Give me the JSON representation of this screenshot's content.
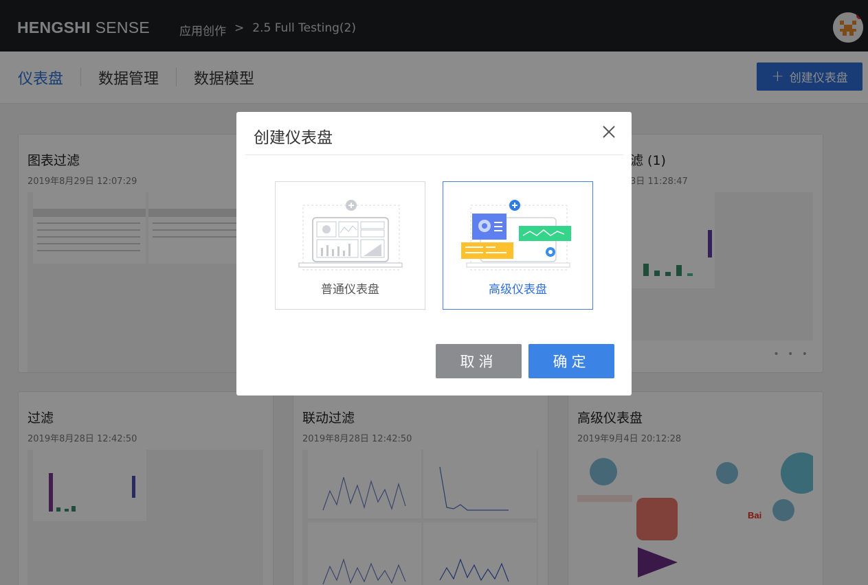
{
  "header": {
    "brand_bold": "HENGSHI",
    "brand_light": " SENSE",
    "breadcrumb": [
      "应用创作",
      ">",
      "2.5 Full Testing(2)"
    ]
  },
  "nav": {
    "tabs": [
      "仪表盘",
      "数据管理",
      "数据模型"
    ],
    "active_tab": "仪表盘",
    "create_label": "创建仪表盘",
    "accent_color": "#2e6ed8"
  },
  "cards": [
    {
      "title": "图表过滤",
      "date": "2019年8月29日 12:07:29"
    },
    {
      "title": "滤 (1)",
      "date": "3日 11:28:47"
    },
    {
      "title": "过滤",
      "date": "2019年8月28日 12:42:50"
    },
    {
      "title": "联动过滤",
      "date": "2019年8月28日 12:42:50"
    },
    {
      "title": "高级仪表盘",
      "date": "2019年9月4日 20:12:28"
    }
  ],
  "more_label": "• • •",
  "modal": {
    "title": "创建仪表盘",
    "options": [
      {
        "label": "普通仪表盘",
        "selected": false
      },
      {
        "label": "高级仪表盘",
        "selected": true
      }
    ],
    "cancel_label": "取消",
    "ok_label": "确定"
  }
}
